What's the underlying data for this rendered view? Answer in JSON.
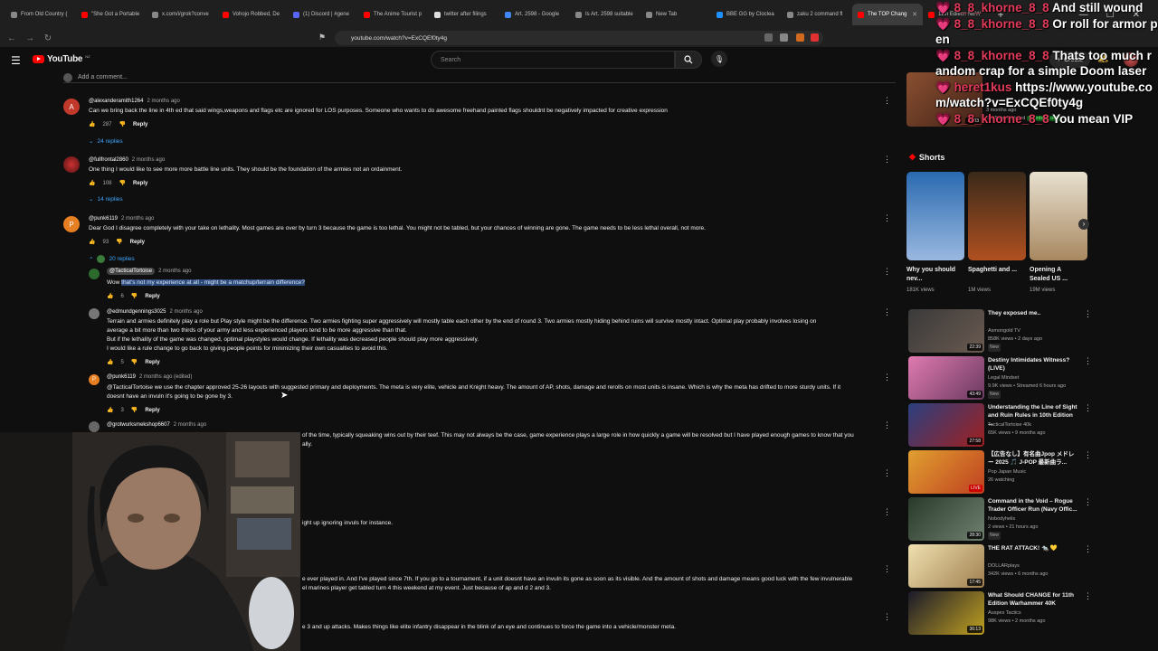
{
  "browser": {
    "tabs": [
      {
        "label": "From Old Country (",
        "color": "#888888"
      },
      {
        "label": "\"She Got a Portable",
        "color": "#ff0000"
      },
      {
        "label": "x.com/i/grok?conve",
        "color": "#888888"
      },
      {
        "label": "Vohojo Robbed, De",
        "color": "#ff0000"
      },
      {
        "label": "(1) Discord | #gene",
        "color": "#5865f2"
      },
      {
        "label": "The Anime Tourist p",
        "color": "#ff0000"
      },
      {
        "label": "twitter after filings",
        "color": "#dddddd"
      },
      {
        "label": "Art. 2598 - Google",
        "color": "#4285f4"
      },
      {
        "label": "Is Art. 2598 suitable",
        "color": "#888888"
      },
      {
        "label": "New Tab",
        "color": "#888888"
      },
      {
        "label": "BBE GG by Cloclea",
        "color": "#1e90ff"
      },
      {
        "label": "zaku 2 command fl",
        "color": "#888888"
      },
      {
        "label": "The TOP Chang",
        "color": "#ff0000",
        "active": true
      },
      {
        "label": "11th Edition NEW",
        "color": "#ff0000"
      }
    ],
    "url": "youtube.com/watch?v=ExCQEf0ty4g",
    "new_tab_symbol": "+"
  },
  "youtube": {
    "logo_text": "YouTube",
    "logo_country": "NZ",
    "search_placeholder": "Search",
    "create_label": "Create",
    "add_comment_placeholder": "Add a comment..."
  },
  "comments": [
    {
      "avatar_letter": "A",
      "avatar_color": "#c0392b",
      "user": "@alexanderamith1264",
      "ago": "2 months ago",
      "text": "Can we bring back the line in 4th ed that said wings,weapons and flags etc are ignored for LOS purposes. Someone who wants to do awesome freehand painted flags shouldnt be negatively impacted for creative expression",
      "likes": "287",
      "reply": "Reply",
      "replies": "24 replies"
    },
    {
      "avatar_letter": "",
      "avatar_color": "#8a1c1c",
      "user": "@fullfrontal2860",
      "ago": "2 months ago",
      "text": "One thing I would like to see more more battle line units. They should be the foundation of the armies not an ordainment.",
      "likes": "108",
      "reply": "Reply",
      "replies": "14 replies"
    },
    {
      "avatar_letter": "P",
      "avatar_color": "#e67e22",
      "user": "@punk6119",
      "ago": "2 months ago",
      "text": "Dear God I disagree completely with your take on lethality. Most games are over by turn 3 because the game is too lethal. You might not be tabled, but your chances of winning are gone. The game needs to be less lethal overall, not more.",
      "likes": "93",
      "reply": "Reply",
      "replies": "20 replies"
    }
  ],
  "replies": [
    {
      "user": "@TacticalTortoise",
      "ago": "2 months ago",
      "prefix": "Wow ",
      "text": "that's not my experience at all - might be a matchup/terrain difference?",
      "likes": "6",
      "reply": "Reply"
    },
    {
      "user": "@edmundgennings3025",
      "ago": "2 months ago",
      "lines": [
        "Terrain and armies definitely play a role but Play style might be the difference. Two armies fighting super aggressively will mostly table each other by the end of round 3. Two armies mostly hiding behind ruins will survive mostly intact. Optimal play probably involves losing on",
        "average a bit more than two thirds of your army and less experienced players tend to be more aggressive than that.",
        "But if the lethality of the game was changed, optimal playstyles would change. If lethality was decreased people should play more aggressively.",
        "I would like a rule change to go back to giving people points for minimizing their own casualties to avoid this."
      ],
      "likes": "5",
      "reply": "Reply"
    },
    {
      "user": "@punk6119",
      "ago": "2 months ago (edited)",
      "mention": "@TacticalTortoise",
      "lines": [
        " we use the chapter approved 25-26 layouts with suggested primary and deployments. The meta is very elite, vehicle and Knight heavy. The amount of AP, shots, damage and rerolls on most units is insane. Which is why the meta has drifted to more sturdy units. If it",
        "doesnt have an invuln it's going to be gone by 3."
      ],
      "likes": "3",
      "reply": "Reply"
    },
    {
      "user": "@grotwurksmekshop6607",
      "ago": "2 months ago",
      "lines": [
        "of the time, typically squeaking wins out by their teef. This may not always be the case, game experience plays a large role in how quickly a game will be resolved but I have played enough games to know that you",
        "ally."
      ]
    }
  ],
  "partial_texts": [
    "ight up ignoring invuls for instance.",
    "e ever played in. And I've played since 7th. If you go to a tournament, if a unit doesnt have an invuln its gone as soon as its visible. And the amount of shots and damage means good luck with the few invulnerable",
    "el marines player get tabled turn 4 this weekend at my event. Just because of ap and d 2 and 3.",
    "e 3 and up attacks. Makes things like elite infantry disappear in the blink of an eye and continues to force the game into a vehicle/monster meta."
  ],
  "sidebar": {
    "top_item": {
      "title": "",
      "channel": "YouTube featured",
      "badge": "Members only",
      "meta": "3 months ago",
      "duration": "14:03"
    },
    "shorts_label": "Shorts",
    "shorts": [
      {
        "title": "Why you should nev...",
        "views": "181K views"
      },
      {
        "title": "Spaghetti and ...",
        "views": "1M views"
      },
      {
        "title": "Opening A Sealed US ...",
        "views": "19M views"
      }
    ],
    "videos": [
      {
        "title": "They exposed me..",
        "channel": "Asmongold TV",
        "meta": "858K views • 2 days ago",
        "badge": "New",
        "duration": "22:39"
      },
      {
        "title": "Destiny Intimidates Witness? (LIVE)",
        "channel": "Legal Mindset",
        "meta": "9.9K views • Streamed 6 hours ago",
        "badge": "New",
        "duration": "43:49"
      },
      {
        "title": "Understanding the Line of Sight and Ruin Rules in 10th Edition ...",
        "channel": "TacticalTortoise 40k",
        "meta": "65K views • 9 months ago",
        "badge": "",
        "duration": "27:58"
      },
      {
        "title": "【広告なし】有名曲Jpop メドレー 2025 🎵 J-POP 最新曲ラ...",
        "channel": "Pop Japan Music",
        "meta": "26 watching",
        "badge": "",
        "duration": "LIVE"
      },
      {
        "title": "Command in the Void – Rogue Trader Officer Run (Navy Offic...",
        "channel": "Nobodyhelis",
        "meta": "2 views • 21 hours ago",
        "badge": "New",
        "duration": "28:30"
      },
      {
        "title": "THE RAT ATTACK! 🐀 💛",
        "channel": "DOLLARplays",
        "meta": "342K views • 6 months ago",
        "badge": "",
        "duration": "17:45"
      },
      {
        "title": "What Should CHANGE for 11th Edition Warhammer 40K",
        "channel": "Auspex Tactics",
        "meta": "98K views • 2 months ago",
        "badge": "",
        "duration": "36:13"
      }
    ]
  },
  "chat_overlay": [
    {
      "user": "8_8_khorne_8_8",
      "text": "And still wound"
    },
    {
      "user": "8_8_khorne_8_8",
      "text": "Or roll for armor pen"
    },
    {
      "user": "8_8_khorne_8_8",
      "text": "Thats too much random crap for a simple Doom laser"
    },
    {
      "user": "heret1kus",
      "text": "https://www.youtube.com/watch?v=ExCQEf0ty4g"
    },
    {
      "user": "8_8_khorne_8_8",
      "text": "You mean VIP"
    }
  ]
}
